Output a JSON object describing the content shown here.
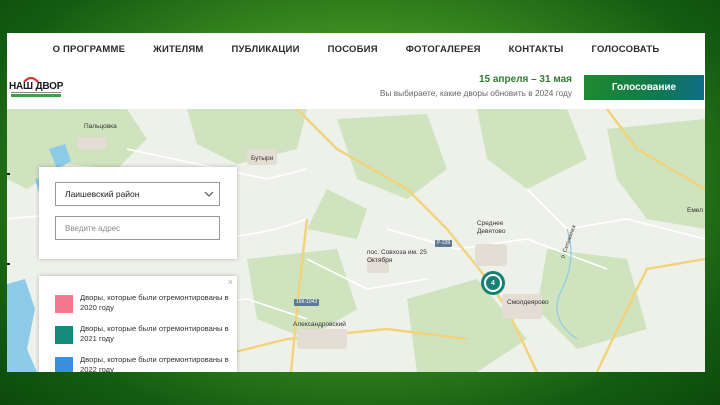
{
  "nav": [
    "О ПРОГРАММЕ",
    "ЖИТЕЛЯМ",
    "ПУБЛИКАЦИИ",
    "ПОСОБИЯ",
    "ФОТОГАЛЕРЕЯ",
    "КОНТАКТЫ",
    "ГОЛОСОВАТЬ"
  ],
  "header": {
    "logo": "НАШ ДВОР",
    "dates": "15 апреля – 31 мая",
    "tagline": "Вы выбираете, какие дворы обновить в 2024 году",
    "vote_button": "Голосование"
  },
  "filter": {
    "district": "Лаишевский район",
    "address_placeholder": "Введите адрес"
  },
  "legend": {
    "close": "×",
    "items": [
      {
        "text": "Дворы, которые были отремонтированы в 2020 году",
        "color": "#f27891"
      },
      {
        "text": "Дворы, которые были отремонтированы в 2021 году",
        "color": "#178a7e"
      },
      {
        "text": "Дворы, которые были отремонтированы в 2022 году",
        "color": "#3b8fe0"
      }
    ]
  },
  "map": {
    "places": [
      "Пальцовка",
      "Бутыри",
      "пос. Совхоза им. 25 Октября",
      "Среднее Девятово",
      "Смолдеярово",
      "Александровский",
      "Емел",
      "р. Сельминка"
    ],
    "roads": [
      "Р-239",
      "16К-1043"
    ],
    "cluster_count": "4"
  },
  "colors": {
    "accent": "#178076",
    "brand_green": "#2e7d32"
  }
}
